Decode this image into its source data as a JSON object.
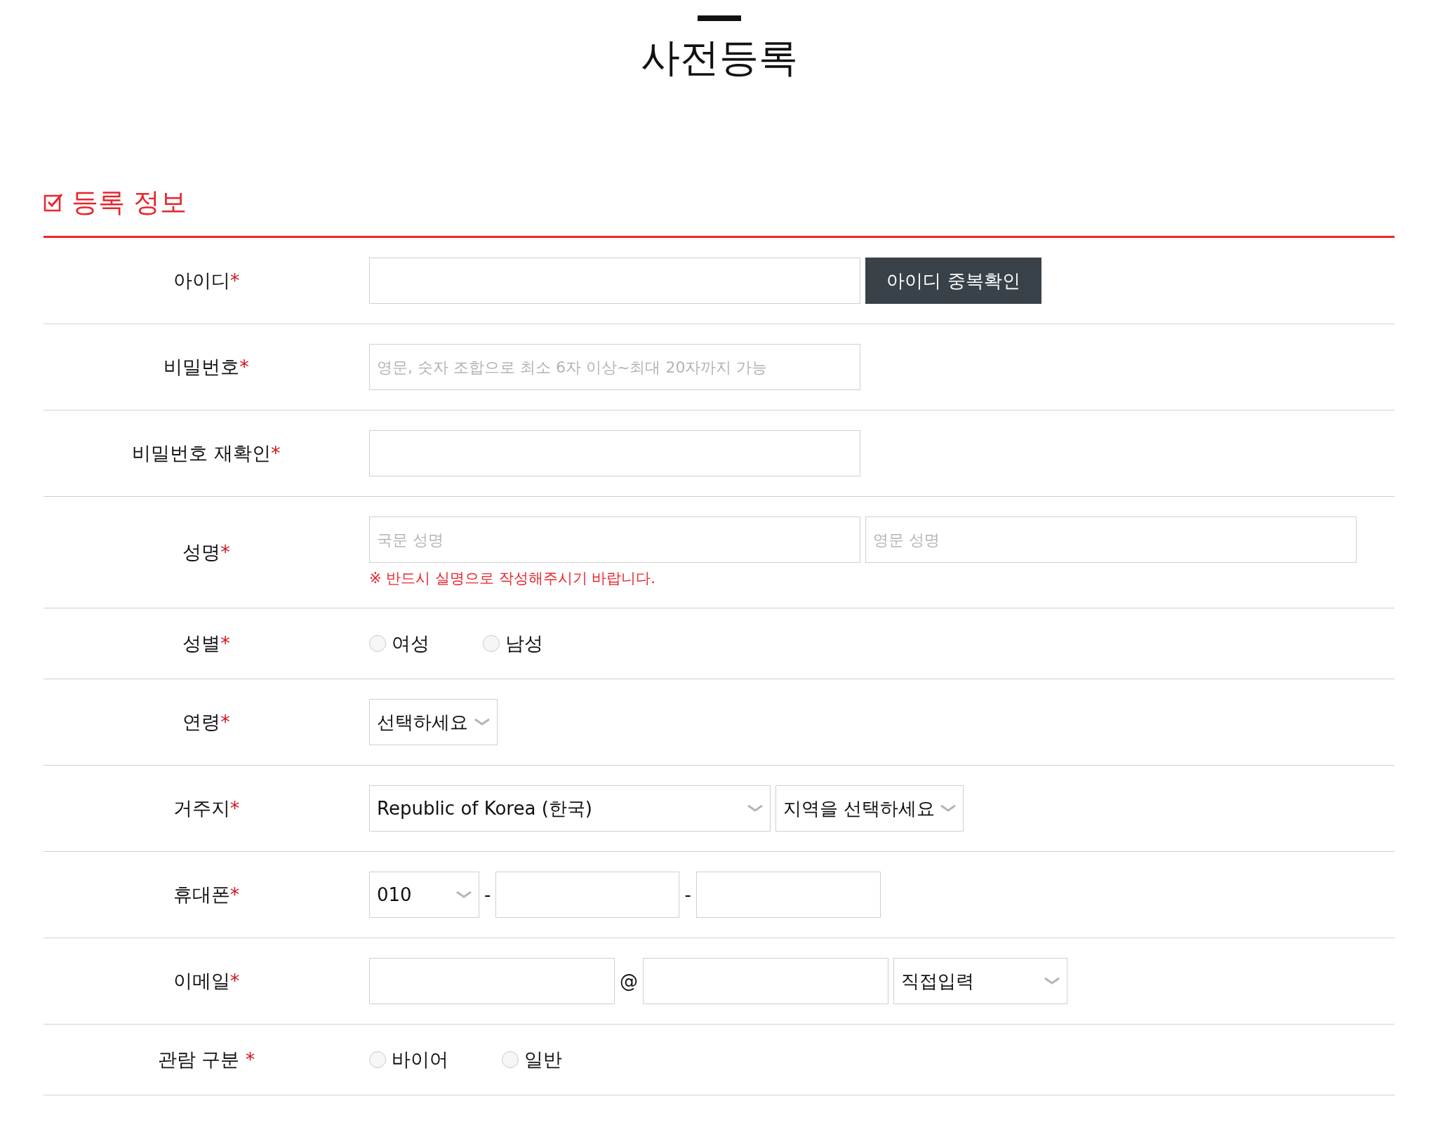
{
  "page_title": "사전등록",
  "section": {
    "title": "등록 정보"
  },
  "rows": [
    {
      "kind": "id",
      "label": "아이디",
      "mark": "*",
      "controls": [
        {
          "kind": "input"
        },
        {
          "kind": "button",
          "label": "아이디 중복확인"
        }
      ]
    },
    {
      "kind": "password",
      "label": "비밀번호",
      "mark": "*",
      "controls": [
        {
          "kind": "input",
          "placeholder": "영문, 숫자 조합으로 최소 6자 이상~최대 20자까지 가능"
        }
      ]
    },
    {
      "kind": "password_confirm",
      "label": "비밀번호 재확인",
      "mark": "*",
      "controls": [
        {
          "kind": "input"
        }
      ]
    },
    {
      "kind": "name",
      "label": "성명",
      "mark": "*",
      "controls": [
        {
          "kind": "input",
          "placeholder": "국문 성명"
        },
        {
          "kind": "input",
          "placeholder": "영문 성명"
        }
      ],
      "note": "※ 반드시 실명으로 작성해주시기 바랍니다."
    },
    {
      "kind": "gender",
      "label": "성별",
      "mark": "*",
      "controls": [
        {
          "kind": "radio",
          "label": "여성",
          "selected": false
        },
        {
          "kind": "radio",
          "label": "남성",
          "selected": false
        }
      ]
    },
    {
      "kind": "age",
      "label": "연령",
      "mark": "*",
      "controls": [
        {
          "kind": "select",
          "value": "선택하세요"
        }
      ]
    },
    {
      "kind": "address",
      "label": "거주지",
      "mark": "*",
      "controls": [
        {
          "kind": "select",
          "value": "Republic of Korea (한국)"
        },
        {
          "kind": "select",
          "value": "지역을 선택하세요"
        }
      ]
    },
    {
      "kind": "phone",
      "label": "휴대폰",
      "mark": "*",
      "controls": [
        {
          "kind": "select",
          "value": "010"
        },
        {
          "kind": "separator",
          "text": "-"
        },
        {
          "kind": "input"
        },
        {
          "kind": "separator",
          "text": "-"
        },
        {
          "kind": "input"
        }
      ]
    },
    {
      "kind": "email",
      "label": "이메일",
      "mark": "*",
      "controls": [
        {
          "kind": "input"
        },
        {
          "kind": "separator",
          "text": "@"
        },
        {
          "kind": "input"
        },
        {
          "kind": "select",
          "value": "직접입력"
        }
      ]
    },
    {
      "kind": "visitor_type",
      "label": "관람 구분",
      "mark": " *",
      "controls": [
        {
          "kind": "radio",
          "label": "바이어",
          "selected": false
        },
        {
          "kind": "radio",
          "label": "일반",
          "selected": false
        }
      ]
    }
  ]
}
